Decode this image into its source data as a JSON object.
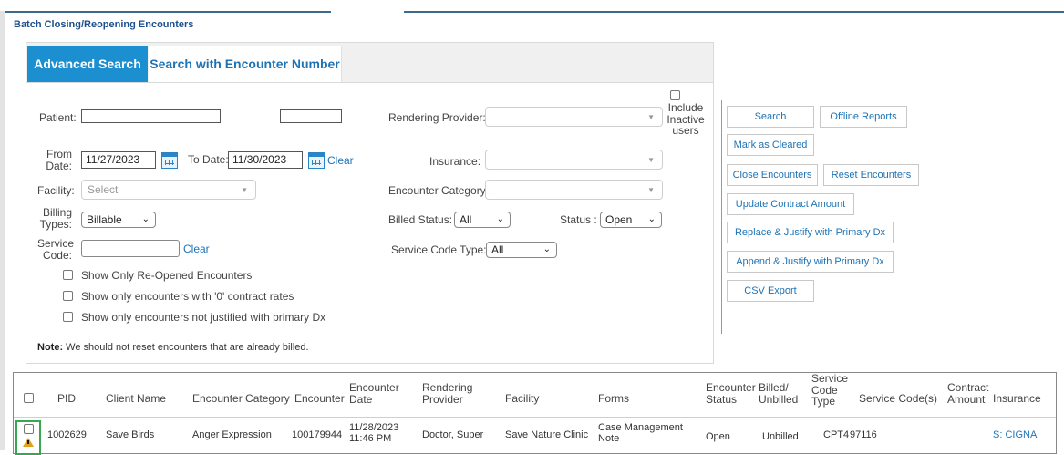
{
  "page": {
    "title": "Batch Closing/Reopening Encounters"
  },
  "tabs": [
    {
      "label": "Advanced Search",
      "active": true
    },
    {
      "label": "Search with Encounter Number",
      "active": false
    }
  ],
  "form": {
    "patient_label": "Patient:",
    "patient_value": "",
    "patient_value2": "",
    "rendering_provider_label": "Rendering Provider:",
    "rendering_provider_value": "",
    "include_inactive_label": "Include Inactive users",
    "from_date_label": "From Date:",
    "from_date_value": "11/27/2023",
    "to_date_label": "To Date:",
    "to_date_value": "11/30/2023",
    "clear_label": "Clear",
    "insurance_label": "Insurance:",
    "insurance_value": "",
    "facility_label": "Facility:",
    "facility_placeholder": "Select",
    "encounter_category_label": "Encounter Category:",
    "encounter_category_value": "",
    "billing_types_label": "Billing Types:",
    "billing_types_value": "Billable",
    "billed_status_label": "Billed Status:",
    "billed_status_value": "All",
    "status_label": "Status :",
    "status_value": "Open",
    "service_code_label": "Service Code:",
    "service_code_value": "",
    "service_code_clear": "Clear",
    "service_code_type_label": "Service Code Type:",
    "service_code_type_value": "All",
    "options": [
      "Show Only Re-Opened Encounters",
      "Show only encounters with '0' contract rates",
      "Show only encounters not justified with primary Dx"
    ],
    "note_bold": "Note:",
    "note_text": " We should not reset encounters that are already billed."
  },
  "actions": {
    "search": "Search",
    "offline_reports": "Offline Reports",
    "mark_as_cleared": "Mark as Cleared",
    "close_encounters": "Close Encounters",
    "reset_encounters": "Reset Encounters",
    "update_contract_amount": "Update Contract Amount",
    "replace_justify": "Replace & Justify with Primary Dx",
    "append_justify": "Append & Justify with Primary Dx",
    "csv_export": "CSV Export"
  },
  "table": {
    "headers": {
      "pid": "PID",
      "client_name": "Client Name",
      "encounter_category": "Encounter Category",
      "encounter": "Encounter",
      "encounter_date": "Encounter Date",
      "rendering_provider": "Rendering Provider",
      "facility": "Facility",
      "forms": "Forms",
      "encounter_status": "Encounter Status",
      "billed_unbilled": "Billed/ Unbilled",
      "service_code_type": "Service Code Type",
      "service_codes": "Service Code(s)",
      "contract_amount": "Contract Amount",
      "insurance": "Insurance"
    },
    "rows": [
      {
        "pid": "1002629",
        "client_name": "Save Birds",
        "encounter_category": "Anger Expression",
        "encounter": "100179944",
        "encounter_date": "11/28/2023 11:46 PM",
        "rendering_provider": "Doctor, Super",
        "facility": "Save Nature Clinic",
        "forms": "Case Management Note",
        "encounter_status": "Open",
        "billed_unbilled": "Unbilled",
        "service_code_type": "CPT4",
        "service_codes": "97116",
        "contract_amount": "",
        "insurance_prefix": "S:",
        "insurance_name": " CIGNA"
      }
    ]
  },
  "colors": {
    "accent": "#1c8fd1",
    "link": "#1e73b5",
    "title": "#1c4f8c",
    "warning": "#e0a21b",
    "highlight": "#36a852"
  }
}
